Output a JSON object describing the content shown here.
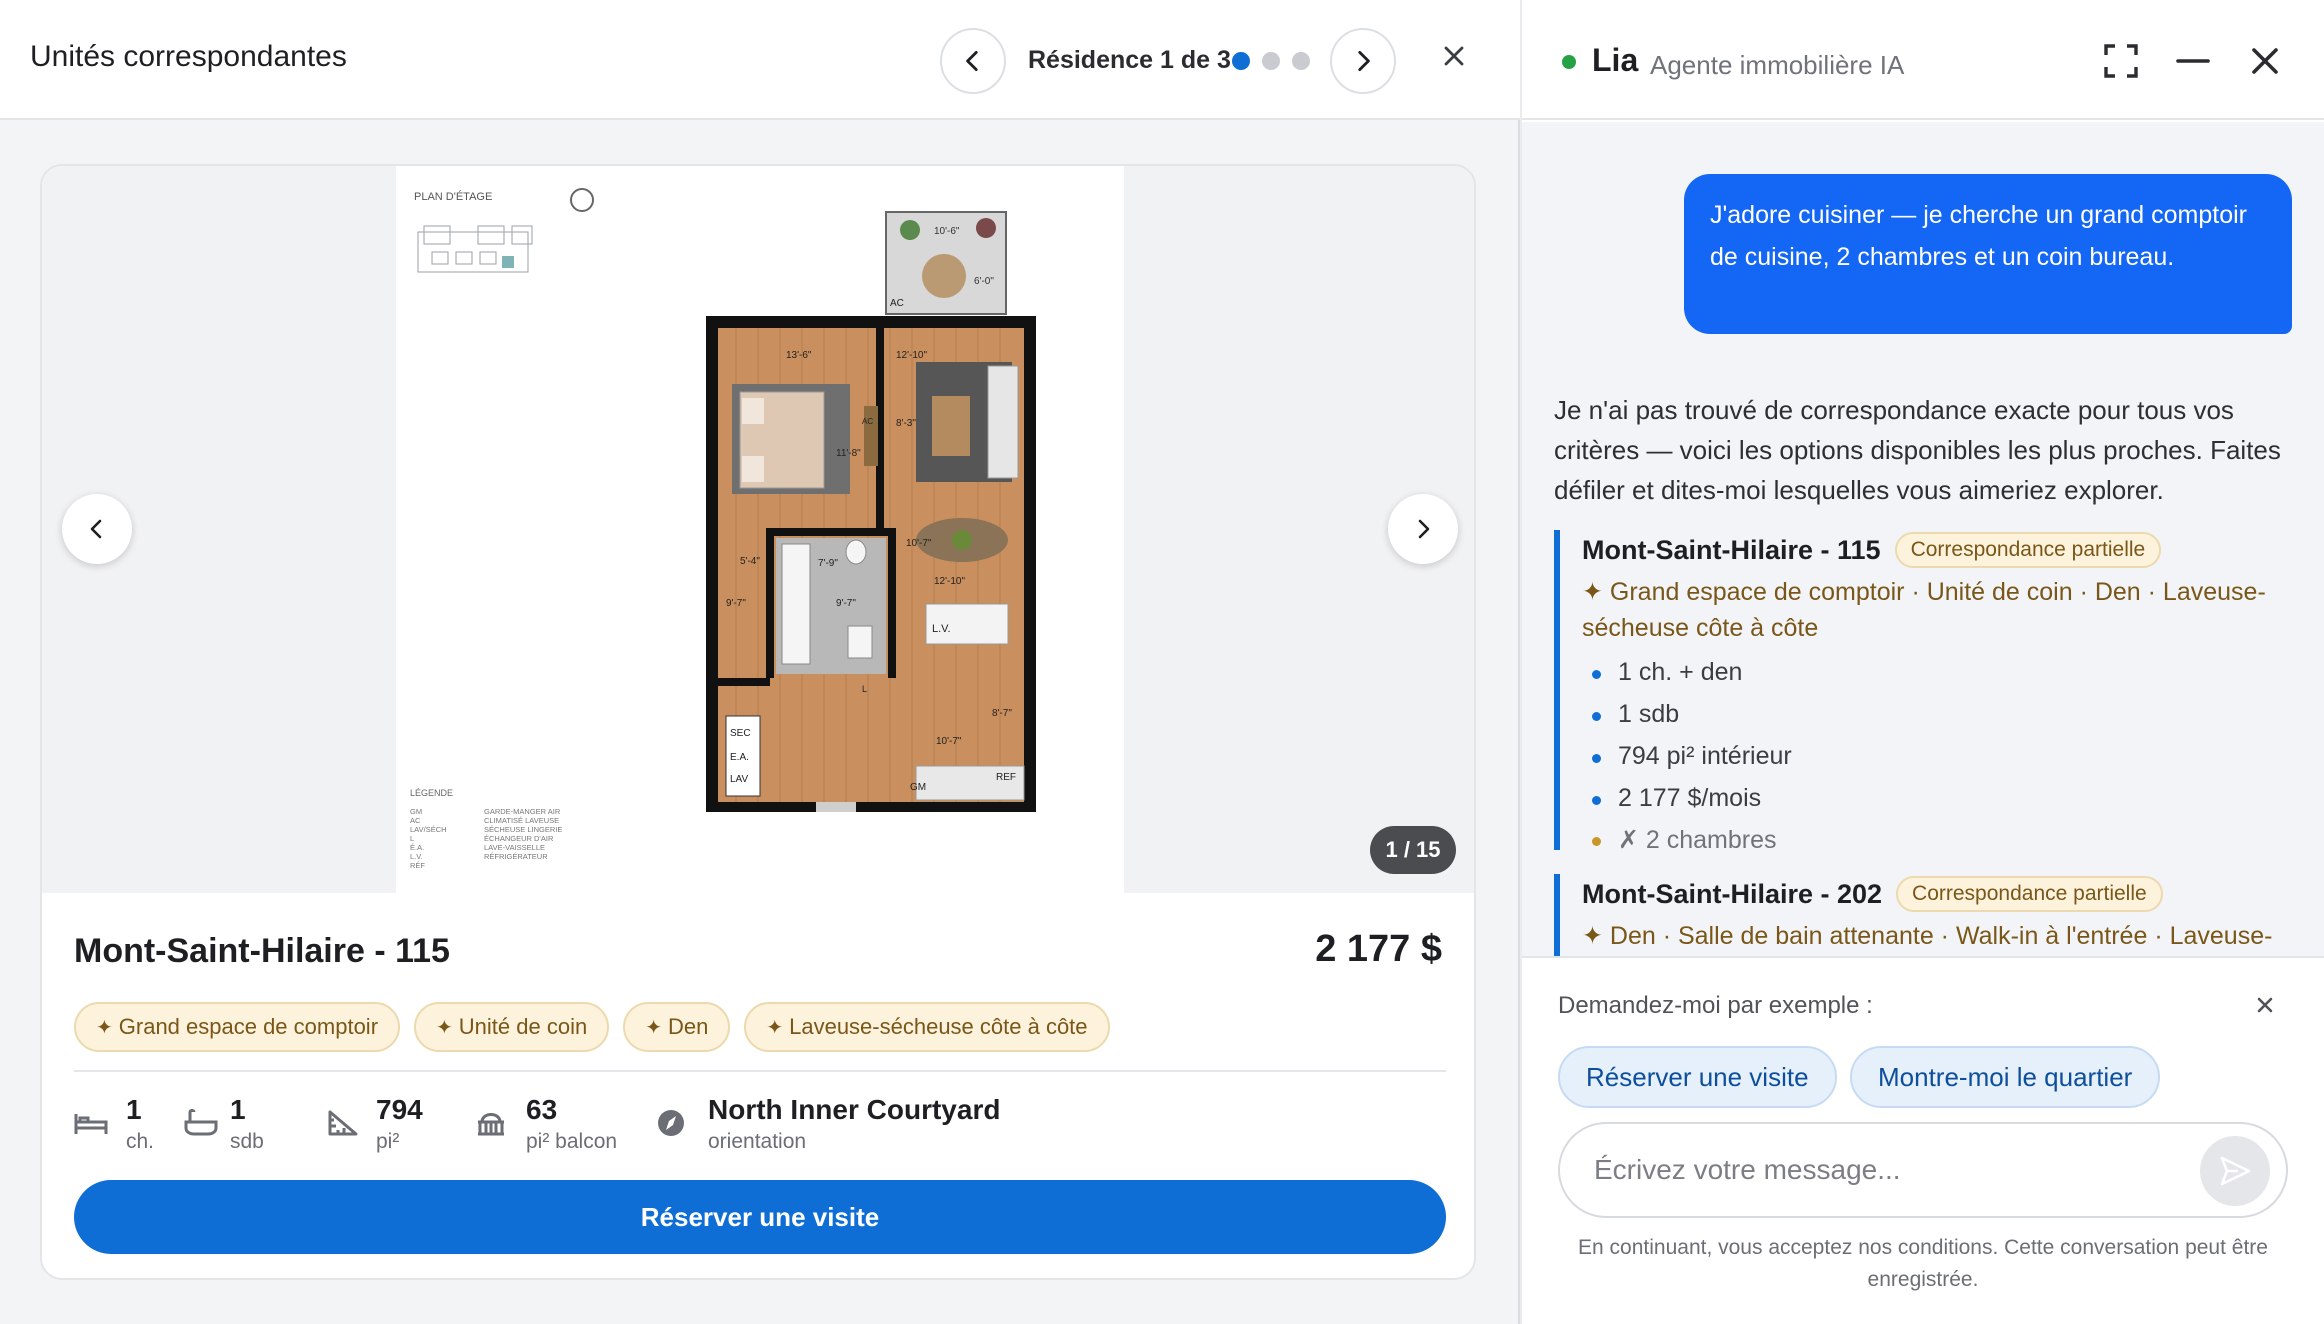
{
  "listing": {
    "header_title": "Unités correspondantes",
    "residence_counter": "Résidence 1 de 3",
    "image_counter": "1 / 15",
    "unit_name": "Mont-Saint-Hilaire - 115",
    "price": "2 177 $",
    "tags": [
      "Grand espace de comptoir",
      "Unité de coin",
      "Den",
      "Laveuse-sécheuse côte à côte"
    ],
    "stats": {
      "bedrooms": {
        "value": "1",
        "label": "ch.",
        "icon": "bed-icon"
      },
      "bathrooms": {
        "value": "1",
        "label": "sdb",
        "icon": "bathtub-icon"
      },
      "area": {
        "value": "794",
        "label": "pi²",
        "icon": "ruler-icon"
      },
      "balcony": {
        "value": "63",
        "label": "pi² balcon",
        "icon": "balcony-icon"
      },
      "orientation": {
        "value": "North Inner Courtyard",
        "label": "orientation",
        "icon": "compass-icon"
      }
    },
    "book_button": "Réserver une visite",
    "floorplan": {
      "title": "PLAN D'ÉTAGE",
      "legend_title": "LÉGENDE",
      "legend_codes": [
        "GM",
        "AC",
        "LAV/SÉCH",
        "L",
        "É.A.",
        "L.V.",
        "RÉF"
      ],
      "legend_values": [
        "GARDE-MANGER AIR",
        "CLIMATISÉ LAVEUSE",
        "SÉCHEUSE LINGERIE",
        "ÉCHANGEUR D'AIR",
        "LAVE-VAISSELLE",
        "RÉFRIGÉRATEUR"
      ],
      "room_labels": {
        "ac1": "AC",
        "ac2": "AC",
        "lv": "L.V.",
        "l": "L",
        "sec": "SEC",
        "ea": "E.A.",
        "lav": "LAV",
        "gm": "GM",
        "ref": "REF"
      },
      "dimensions": {
        "balcony_w": "10'-6\"",
        "balcony_h": "6'-0\"",
        "bed_w": "13'-6\"",
        "bed_h": "11'-8\"",
        "living_w": "12'-10\"",
        "living_h": "8'-3\"",
        "bath_w": "7'-9\"",
        "bath_h": "9'-7\"",
        "closet_w": "5'-4\"",
        "closet_h": "9'-7\"",
        "dining_w": "12'-10\"",
        "dining_h": "10'-7\"",
        "kitchen_w": "10'-7\"",
        "kitchen_h": "8'-7\""
      }
    }
  },
  "chat": {
    "agent_name": "Lia",
    "agent_role": "Agente immobilière IA",
    "user_message": "J'adore cuisiner — je cherche un grand comptoir de cuisine, 2 chambres et un coin bureau.",
    "bot_intro": "Je n'ai pas trouvé de correspondance exacte pour tous vos critères — voici les options disponibles les plus proches. Faites défiler et dites-moi lesquelles vous aimeriez explorer.",
    "matches": [
      {
        "title": "Mont-Saint-Hilaire - 115",
        "badge": "Correspondance partielle",
        "features": "✦ Grand espace de comptoir · Unité de coin · Den · Laveuse-sécheuse côte à côte",
        "bullets": [
          "1 ch. + den",
          "1 sdb",
          "794 pi² intérieur",
          "2 177 $/mois"
        ],
        "missing": "✗ 2 chambres"
      },
      {
        "title": "Mont-Saint-Hilaire - 202",
        "badge": "Correspondance partielle",
        "features": "✦ Den · Salle de bain attenante · Walk-in à l'entrée · Laveuse-"
      }
    ],
    "suggestions_label": "Demandez-moi par exemple :",
    "suggestions": [
      "Réserver une visite",
      "Montre-moi le quartier"
    ],
    "input_placeholder": "Écrivez votre message...",
    "disclaimer": "En continuant, vous acceptez nos conditions. Cette conversation peut être enregistrée."
  },
  "colors": {
    "accent": "#0e6ed6",
    "user_bubble": "#1466f5",
    "tag_bg": "#fdf3dd",
    "tag_text": "#7a5718",
    "online": "#25a244"
  }
}
